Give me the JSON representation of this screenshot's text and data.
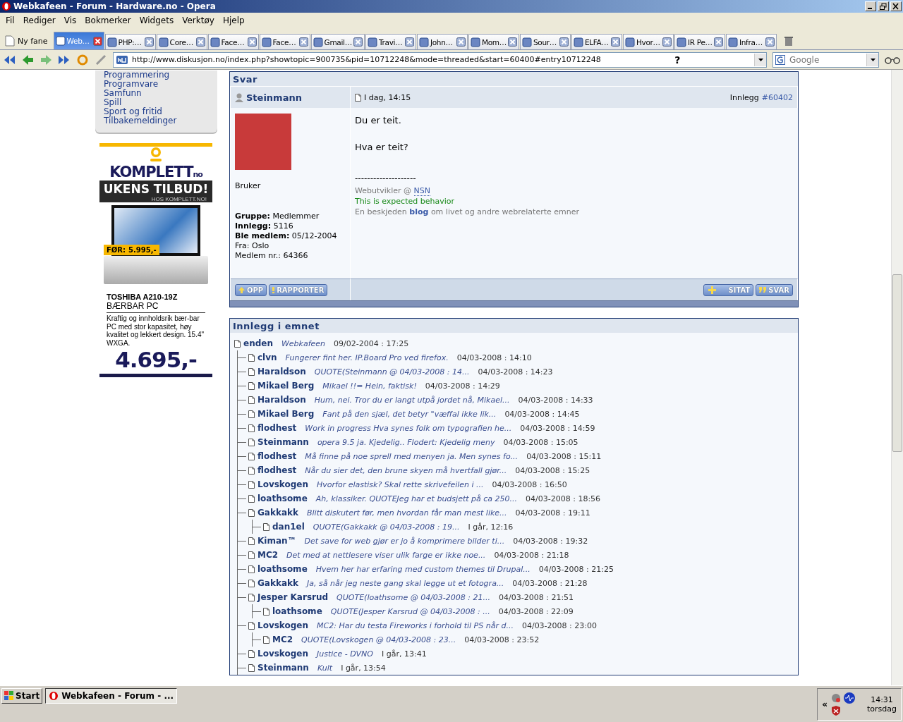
{
  "window": {
    "title": "Webkafeen - Forum - Hardware.no - Opera"
  },
  "menu": [
    "Fil",
    "Rediger",
    "Vis",
    "Bokmerker",
    "Widgets",
    "Verktøy",
    "Hjelp"
  ],
  "new_tab_button": {
    "label": "Ny fane"
  },
  "tabs": [
    {
      "label": "Web…",
      "selected": true
    },
    {
      "label": "PHP:…",
      "selected": false
    },
    {
      "label": "Core…",
      "selected": false
    },
    {
      "label": "Face…",
      "selected": false
    },
    {
      "label": "Face…",
      "selected": false
    },
    {
      "label": "Gmail…",
      "selected": false
    },
    {
      "label": "Travi…",
      "selected": false
    },
    {
      "label": "John…",
      "selected": false
    },
    {
      "label": "Mom…",
      "selected": false
    },
    {
      "label": "Sour…",
      "selected": false
    },
    {
      "label": "ELFA…",
      "selected": false
    },
    {
      "label": "Hvor…",
      "selected": false
    },
    {
      "label": "IR Pe…",
      "selected": false
    },
    {
      "label": "Infra…",
      "selected": false
    }
  ],
  "address_bar": {
    "url": "http://www.diskusjon.no/index.php?showtopic=900735&pid=10712248&mode=threaded&start=60400#entry10712248",
    "help": "?"
  },
  "search": {
    "placeholder": "Google"
  },
  "sidebar": {
    "items": [
      "Programmering",
      "Programvare",
      "Samfunn",
      "Spill",
      "Sport og fritid",
      "Tilbakemeldinger"
    ]
  },
  "ad": {
    "brand": "KOMPLETT",
    "brand_suffix": "no",
    "headline": "UKENS TILBUD!",
    "subline": "HOS KOMPLETT.NO!",
    "old_price_label": "FØR:",
    "old_price": "5.995,-",
    "product": "TOSHIBA A210-19Z",
    "category": "BÆRBAR PC",
    "description": "Kraftig og innholdsrik bær-bar PC med stor kapasitet, høy kvalitet og lekkert design. 15.4\" WXGA.",
    "price": "4.695,-"
  },
  "post": {
    "section_title": "Svar",
    "author": "Steinmann",
    "date": "I dag, 14:15",
    "post_label": "Innlegg",
    "post_number": "#60402",
    "rank": "Bruker",
    "details": [
      "**Gruppe:** Medlemmer",
      "**Innlegg:** 5116",
      "**Ble medlem:** 05/12-2004",
      "Fra: Oslo",
      "Medlem nr.: 64366"
    ],
    "body": [
      "Du er teit.",
      "Hva er teit?"
    ],
    "signature_rule": "--------------------",
    "signature": [
      {
        "parts": [
          {
            "text": "Webutvikler @ ",
            "link": false
          },
          {
            "text": "NSN",
            "link": true
          }
        ]
      },
      {
        "color": "#1a8a1a",
        "parts": [
          {
            "text": "This is expected behavior",
            "link": false
          }
        ]
      },
      {
        "parts": [
          {
            "text": "En beskjeden ",
            "link": false
          },
          {
            "text": "blog",
            "link": true
          },
          {
            "text": " om livet og andre webrelaterte emner",
            "link": false
          }
        ]
      }
    ],
    "left_buttons": [
      "OPP",
      "RAPPORTER"
    ],
    "right_buttons": [
      "SITAT",
      "SVAR"
    ]
  },
  "thread": {
    "title": "Innlegg i emnet",
    "root": {
      "author": "enden",
      "snippet": "Webkafeen",
      "date": "09/02-2004 : 17:25",
      "children": [
        {
          "author": "clvn",
          "snippet": "Fungerer fint her. IP.Board Pro ved firefox.",
          "date": "04/03-2008 : 14:10"
        },
        {
          "author": "Haraldson",
          "snippet": "QUOTE(Steinmann @ 04/03-2008 : 14...",
          "date": "04/03-2008 : 14:23"
        },
        {
          "author": "Mikael Berg",
          "snippet": "Mikael !!= Hein, faktisk!",
          "date": "04/03-2008 : 14:29"
        },
        {
          "author": "Haraldson",
          "snippet": "Hum, nei. Tror du er langt utpå jordet nå, Mikael...",
          "date": "04/03-2008 : 14:33"
        },
        {
          "author": "Mikael Berg",
          "snippet": "Fant på den sjæl, det betyr \"væffal ikke lik...",
          "date": "04/03-2008 : 14:45"
        },
        {
          "author": "flodhest",
          "snippet": "Work in progress Hva synes folk om typografien he...",
          "date": "04/03-2008 : 14:59"
        },
        {
          "author": "Steinmann",
          "snippet": "opera 9.5 ja. Kjedelig.. Flodert: Kjedelig meny",
          "date": "04/03-2008 : 15:05"
        },
        {
          "author": "flodhest",
          "snippet": "Må finne på noe sprell med menyen ja. Men synes fo...",
          "date": "04/03-2008 : 15:11"
        },
        {
          "author": "flodhest",
          "snippet": "Når du sier det, den brune skyen må hvertfall gjør...",
          "date": "04/03-2008 : 15:25"
        },
        {
          "author": "Lovskogen",
          "snippet": "Hvorfor elastisk? Skal rette skrivefeilen i ...",
          "date": "04/03-2008 : 16:50"
        },
        {
          "author": "loathsome",
          "snippet": "Ah, klassiker. QUOTEJeg har et budsjett på ca 250...",
          "date": "04/03-2008 : 18:56"
        },
        {
          "author": "Gakkakk",
          "snippet": "Blitt diskutert før, men hvordan får man mest like...",
          "date": "04/03-2008 : 19:11",
          "children": [
            {
              "author": "dan1el",
              "snippet": "QUOTE(Gakkakk @ 04/03-2008 : 19...",
              "date": "I går, 12:16"
            }
          ]
        },
        {
          "author": "Kiman™",
          "snippet": "Det save for web gjør er jo å komprimere bilder ti...",
          "date": "04/03-2008 : 19:32"
        },
        {
          "author": "MC2",
          "snippet": "Det med at nettlesere viser ulik farge er ikke noe...",
          "date": "04/03-2008 : 21:18"
        },
        {
          "author": "loathsome",
          "snippet": "Hvem her har erfaring med custom themes til Drupal...",
          "date": "04/03-2008 : 21:25"
        },
        {
          "author": "Gakkakk",
          "snippet": "Ja, så når jeg neste gang skal legge ut et fotogra...",
          "date": "04/03-2008 : 21:28"
        },
        {
          "author": "Jesper Karsrud",
          "snippet": "QUOTE(loathsome @ 04/03-2008 : 21...",
          "date": "04/03-2008 : 21:51",
          "children": [
            {
              "author": "loathsome",
              "snippet": "QUOTE(Jesper Karsrud @ 04/03-2008 : ...",
              "date": "04/03-2008 : 22:09"
            }
          ]
        },
        {
          "author": "Lovskogen",
          "snippet": "MC2: Har du testa Fireworks i forhold til PS når d...",
          "date": "04/03-2008 : 23:00",
          "children": [
            {
              "author": "MC2",
              "snippet": "QUOTE(Lovskogen @ 04/03-2008 : 23...",
              "date": "04/03-2008 : 23:52"
            }
          ]
        },
        {
          "author": "Lovskogen",
          "snippet": "Justice - DVNO",
          "date": "I går, 13:41"
        },
        {
          "author": "Steinmann",
          "snippet": "Kult",
          "date": "I går, 13:54"
        }
      ]
    }
  },
  "taskbar": {
    "start": "Start",
    "tasks": [
      {
        "label": "Webkafeen - Forum - ...",
        "selected": true
      }
    ],
    "tray_toggle": "«",
    "time": "14:31",
    "day": "torsdag"
  }
}
